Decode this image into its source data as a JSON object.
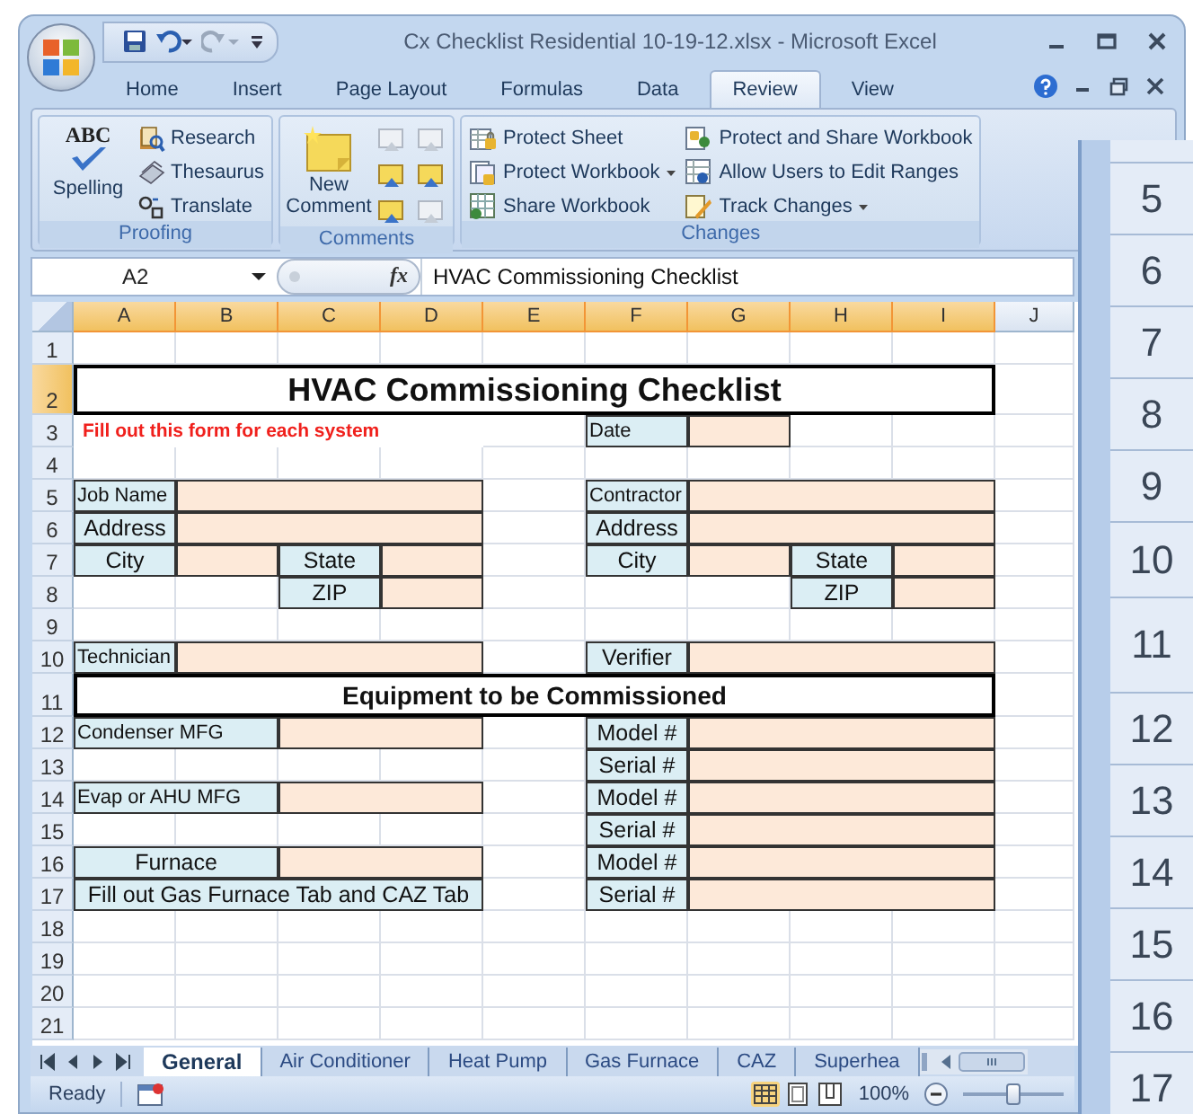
{
  "window": {
    "title": "Cx Checklist Residential 10-19-12.xlsx - Microsoft Excel"
  },
  "ribbon_tabs": [
    {
      "label": "Home",
      "selected": false
    },
    {
      "label": "Insert",
      "selected": false
    },
    {
      "label": "Page Layout",
      "selected": false
    },
    {
      "label": "Formulas",
      "selected": false
    },
    {
      "label": "Data",
      "selected": false
    },
    {
      "label": "Review",
      "selected": true
    },
    {
      "label": "View",
      "selected": false
    }
  ],
  "ribbon_groups": [
    {
      "title": "Proofing",
      "items": [
        {
          "kind": "large",
          "label": "Spelling",
          "badge": "ABC"
        },
        {
          "kind": "small",
          "label": "Research"
        },
        {
          "kind": "small",
          "label": "Thesaurus"
        },
        {
          "kind": "small",
          "label": "Translate"
        }
      ]
    },
    {
      "title": "Comments",
      "items": [
        {
          "kind": "large",
          "label": "New Comment"
        },
        {
          "kind": "icon",
          "disabled": true
        },
        {
          "kind": "icon",
          "disabled": true
        },
        {
          "kind": "icon",
          "disabled": false
        },
        {
          "kind": "icon",
          "disabled": false
        },
        {
          "kind": "icon",
          "disabled": false
        },
        {
          "kind": "icon",
          "disabled": true
        }
      ]
    },
    {
      "title": "Changes",
      "items": [
        {
          "kind": "small",
          "label": "Protect Sheet",
          "dropdown": false
        },
        {
          "kind": "small",
          "label": "Protect Workbook",
          "dropdown": true
        },
        {
          "kind": "small",
          "label": "Share Workbook",
          "dropdown": false
        },
        {
          "kind": "small",
          "label": "Protect and Share Workbook",
          "dropdown": false
        },
        {
          "kind": "small",
          "label": "Allow Users to Edit Ranges",
          "dropdown": false
        },
        {
          "kind": "small",
          "label": "Track Changes",
          "dropdown": true
        }
      ]
    }
  ],
  "formula_bar": {
    "name_box": "A2",
    "function_button": "fx",
    "value": "HVAC Commissioning Checklist"
  },
  "sheet": {
    "columns": [
      {
        "label": "A",
        "selected": true
      },
      {
        "label": "B",
        "selected": true
      },
      {
        "label": "C",
        "selected": true
      },
      {
        "label": "D",
        "selected": true
      },
      {
        "label": "E",
        "selected": true
      },
      {
        "label": "F",
        "selected": true
      },
      {
        "label": "G",
        "selected": true
      },
      {
        "label": "H",
        "selected": true
      },
      {
        "label": "I",
        "selected": true
      },
      {
        "label": "J",
        "selected": false
      }
    ],
    "rows": [
      {
        "number": "1",
        "selected": false,
        "cells": []
      },
      {
        "number": "2",
        "selected": true,
        "cells": [
          {
            "kind": "title",
            "text": "HVAC Commissioning Checklist"
          },
          {
            "kind": "merge"
          },
          {
            "kind": "merge"
          },
          {
            "kind": "merge"
          },
          {
            "kind": "merge"
          },
          {
            "kind": "merge"
          },
          {
            "kind": "merge"
          },
          {
            "kind": "merge"
          },
          {
            "kind": "merge"
          }
        ]
      },
      {
        "number": "3",
        "selected": false,
        "cells": [
          {
            "kind": "note",
            "text": "Fill out this form for each system"
          },
          {
            "kind": "merge"
          },
          {
            "kind": "merge"
          },
          {
            "kind": "merge"
          },
          "",
          {
            "kind": "prompt",
            "text": "Date"
          },
          {
            "kind": "input"
          }
        ]
      },
      {
        "number": "4",
        "selected": false,
        "cells": []
      },
      {
        "number": "5",
        "selected": false,
        "cells": [
          {
            "kind": "prompt",
            "text": "Job Name"
          },
          {
            "kind": "input"
          },
          {
            "kind": "merge"
          },
          {
            "kind": "merge"
          },
          "",
          {
            "kind": "prompt",
            "text": "Contractor"
          },
          {
            "kind": "input"
          },
          {
            "kind": "merge"
          },
          {
            "kind": "merge"
          }
        ]
      },
      {
        "number": "6",
        "selected": false,
        "cells": [
          {
            "kind": "label",
            "text": "Address"
          },
          {
            "kind": "input"
          },
          {
            "kind": "merge"
          },
          {
            "kind": "merge"
          },
          "",
          {
            "kind": "label",
            "text": "Address"
          },
          {
            "kind": "input"
          },
          {
            "kind": "merge"
          },
          {
            "kind": "merge"
          }
        ]
      },
      {
        "number": "7",
        "selected": false,
        "cells": [
          {
            "kind": "label",
            "text": "City"
          },
          {
            "kind": "input"
          },
          {
            "kind": "label",
            "text": "State"
          },
          {
            "kind": "input"
          },
          "",
          {
            "kind": "label",
            "text": "City"
          },
          {
            "kind": "input"
          },
          {
            "kind": "label",
            "text": "State"
          },
          {
            "kind": "input"
          }
        ]
      },
      {
        "number": "8",
        "selected": false,
        "cells": [
          "",
          "",
          {
            "kind": "label",
            "text": "ZIP"
          },
          {
            "kind": "input"
          },
          "",
          "",
          "",
          {
            "kind": "label",
            "text": "ZIP"
          },
          {
            "kind": "input"
          }
        ]
      },
      {
        "number": "9",
        "selected": false,
        "cells": []
      },
      {
        "number": "10",
        "selected": false,
        "cells": [
          {
            "kind": "prompt",
            "text": "Technician"
          },
          {
            "kind": "input"
          },
          {
            "kind": "merge"
          },
          {
            "kind": "merge"
          },
          "",
          {
            "kind": "label",
            "text": "Verifier"
          },
          {
            "kind": "input"
          },
          {
            "kind": "merge"
          },
          {
            "kind": "merge"
          }
        ]
      },
      {
        "number": "11",
        "selected": false,
        "cells": [
          {
            "kind": "heading",
            "text": "Equipment to be Commissioned"
          },
          {
            "kind": "merge"
          },
          {
            "kind": "merge"
          },
          {
            "kind": "merge"
          },
          {
            "kind": "merge"
          },
          {
            "kind": "merge"
          },
          {
            "kind": "merge"
          },
          {
            "kind": "merge"
          },
          {
            "kind": "merge"
          }
        ]
      },
      {
        "number": "12",
        "selected": false,
        "cells": [
          {
            "kind": "prompt",
            "text": "Condenser MFG"
          },
          {
            "kind": "merge"
          },
          {
            "kind": "input"
          },
          {
            "kind": "merge"
          },
          "",
          {
            "kind": "label",
            "text": "Model #"
          },
          {
            "kind": "input"
          },
          {
            "kind": "merge"
          },
          {
            "kind": "merge"
          }
        ]
      },
      {
        "number": "13",
        "selected": false,
        "cells": [
          "",
          "",
          "",
          "",
          "",
          {
            "kind": "label",
            "text": "Serial #"
          },
          {
            "kind": "input"
          },
          {
            "kind": "merge"
          },
          {
            "kind": "merge"
          }
        ]
      },
      {
        "number": "14",
        "selected": false,
        "cells": [
          {
            "kind": "prompt",
            "text": "Evap or AHU MFG"
          },
          {
            "kind": "merge"
          },
          {
            "kind": "input"
          },
          {
            "kind": "merge"
          },
          "",
          {
            "kind": "label",
            "text": "Model #"
          },
          {
            "kind": "input"
          },
          {
            "kind": "merge"
          },
          {
            "kind": "merge"
          }
        ]
      },
      {
        "number": "15",
        "selected": false,
        "cells": [
          "",
          "",
          "",
          "",
          "",
          {
            "kind": "label",
            "text": "Serial #"
          },
          {
            "kind": "input"
          },
          {
            "kind": "merge"
          },
          {
            "kind": "merge"
          }
        ]
      },
      {
        "number": "16",
        "selected": false,
        "cells": [
          {
            "kind": "label",
            "text": "Furnace"
          },
          {
            "kind": "merge"
          },
          {
            "kind": "input"
          },
          {
            "kind": "merge"
          },
          "",
          {
            "kind": "label",
            "text": "Model #"
          },
          {
            "kind": "input"
          },
          {
            "kind": "merge"
          },
          {
            "kind": "merge"
          }
        ]
      },
      {
        "number": "17",
        "selected": false,
        "cells": [
          {
            "kind": "label",
            "text": "Fill out Gas Furnace Tab and CAZ Tab"
          },
          {
            "kind": "merge"
          },
          {
            "kind": "merge"
          },
          {
            "kind": "merge"
          },
          "",
          {
            "kind": "label",
            "text": "Serial #"
          },
          {
            "kind": "input"
          },
          {
            "kind": "merge"
          },
          {
            "kind": "merge"
          }
        ]
      },
      {
        "number": "18",
        "selected": false,
        "cells": []
      },
      {
        "number": "19",
        "selected": false,
        "cells": []
      },
      {
        "number": "20",
        "selected": false,
        "cells": []
      },
      {
        "number": "21",
        "selected": false,
        "cells": []
      }
    ]
  },
  "sheet_tabs": [
    {
      "label": "General",
      "selected": true
    },
    {
      "label": "Air Conditioner",
      "selected": false
    },
    {
      "label": "Heat Pump",
      "selected": false
    },
    {
      "label": "Gas Furnace",
      "selected": false
    },
    {
      "label": "CAZ",
      "selected": false
    },
    {
      "label": "Superhea",
      "selected": false
    }
  ],
  "status_bar": {
    "status": "Ready",
    "views": [
      {
        "kind": "normal",
        "selected": true
      },
      {
        "kind": "layout",
        "selected": false
      },
      {
        "kind": "pagebreak",
        "selected": false
      }
    ],
    "zoom": "100%",
    "zoom_slider": {
      "level": 0.5
    }
  },
  "back_window": {
    "row_numbers": [
      "5",
      "6",
      "7",
      "8",
      "9",
      "10",
      "11",
      "12",
      "13",
      "14",
      "15",
      "16",
      "17"
    ]
  }
}
